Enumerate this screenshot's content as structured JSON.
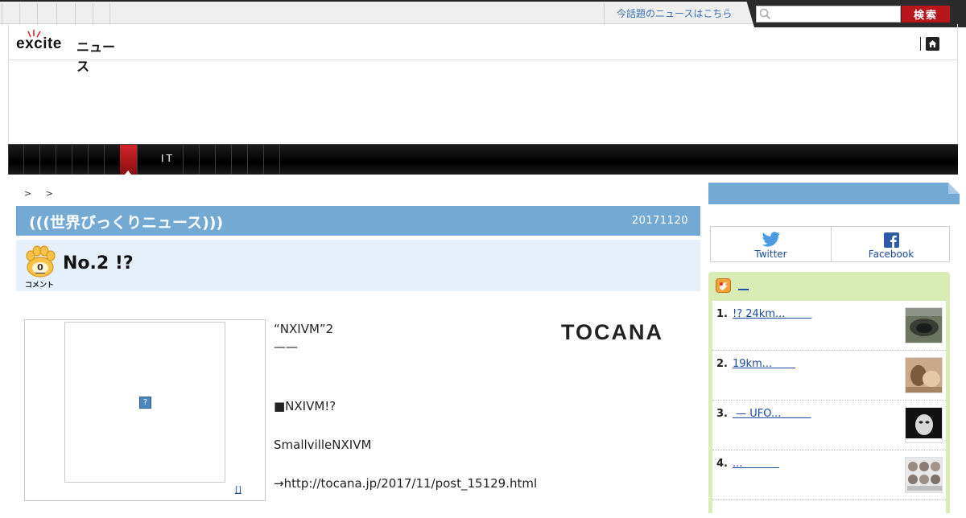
{
  "topbar": {
    "trending_link": "今話題のニュースはこちら",
    "search_placeholder": "",
    "search_button": "検索"
  },
  "logo": {
    "brand": "excite",
    "section": "ニュース"
  },
  "nav": {
    "it_label": "IT"
  },
  "breadcrumb": {
    "separators": [
      ">",
      ">"
    ]
  },
  "category": {
    "title": "(((世界びっくりニュース)))",
    "date": "20171120"
  },
  "headline": {
    "text": "No.2 !?",
    "comment_count": "0",
    "comment_label": "コメント"
  },
  "image": {
    "credit": "[]"
  },
  "article": {
    "paragraphs": [
      "“NXIVM”2",
      "——",
      "■NXIVM!?",
      "SmallvilleNXIVM",
      "→http://tocana.jp/2017/11/post_15129.html"
    ]
  },
  "source_logo": "TOCANA",
  "social": {
    "twitter": "Twitter",
    "facebook": "Facebook"
  },
  "ranking": {
    "title": "__",
    "items": [
      {
        "rank": "1.",
        "title": "!? 24km...        "
      },
      {
        "rank": "2.",
        "title": "19km...       "
      },
      {
        "rank": "3.",
        "title": " — UFO...         "
      },
      {
        "rank": "4.",
        "title": "...           "
      }
    ]
  },
  "colors": {
    "category_blue": "#73a9d3",
    "nav_active_red": "#c41d23",
    "search_red": "#b8151c",
    "ranking_green": "#d9ecb6"
  }
}
